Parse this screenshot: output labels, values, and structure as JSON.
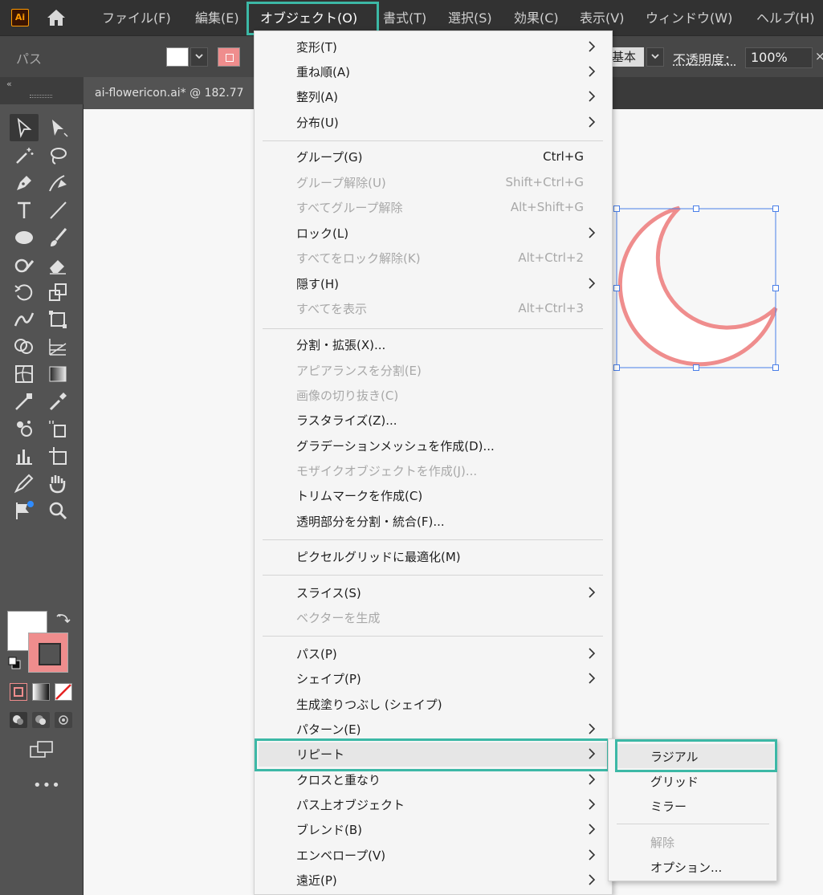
{
  "menubar": {
    "logo": "Ai",
    "items": [
      "ファイル(F)",
      "編集(E)",
      "オブジェクト(O)",
      "書式(T)",
      "選択(S)",
      "効果(C)",
      "表示(V)",
      "ウィンドウ(W)",
      "ヘルプ(H)"
    ]
  },
  "controlbar": {
    "label": "パス",
    "style_value": "基本",
    "opacity_label": "不透明度：",
    "opacity_value": "100%",
    "more": "×"
  },
  "document": {
    "tab_title": "ai-flowericon.ai* @ 182.77"
  },
  "object_menu": {
    "items": [
      {
        "label": "変形(T)",
        "shortcut": "",
        "submenu": true,
        "enabled": true
      },
      {
        "label": "重ね順(A)",
        "shortcut": "",
        "submenu": true,
        "enabled": true
      },
      {
        "label": "整列(A)",
        "shortcut": "",
        "submenu": true,
        "enabled": true
      },
      {
        "label": "分布(U)",
        "shortcut": "",
        "submenu": true,
        "enabled": true
      },
      {
        "label": "グループ(G)",
        "shortcut": "Ctrl+G",
        "submenu": false,
        "enabled": true
      },
      {
        "label": "グループ解除(U)",
        "shortcut": "Shift+Ctrl+G",
        "submenu": false,
        "enabled": false
      },
      {
        "label": "すべてグループ解除",
        "shortcut": "Alt+Shift+G",
        "submenu": false,
        "enabled": false
      },
      {
        "label": "ロック(L)",
        "shortcut": "",
        "submenu": true,
        "enabled": true
      },
      {
        "label": "すべてをロック解除(K)",
        "shortcut": "Alt+Ctrl+2",
        "submenu": false,
        "enabled": false
      },
      {
        "label": "隠す(H)",
        "shortcut": "",
        "submenu": true,
        "enabled": true
      },
      {
        "label": "すべてを表示",
        "shortcut": "Alt+Ctrl+3",
        "submenu": false,
        "enabled": false
      },
      {
        "label": "分割・拡張(X)...",
        "shortcut": "",
        "submenu": false,
        "enabled": true
      },
      {
        "label": "アピアランスを分割(E)",
        "shortcut": "",
        "submenu": false,
        "enabled": false
      },
      {
        "label": "画像の切り抜き(C)",
        "shortcut": "",
        "submenu": false,
        "enabled": false
      },
      {
        "label": "ラスタライズ(Z)...",
        "shortcut": "",
        "submenu": false,
        "enabled": true
      },
      {
        "label": "グラデーションメッシュを作成(D)...",
        "shortcut": "",
        "submenu": false,
        "enabled": true
      },
      {
        "label": "モザイクオブジェクトを作成(J)...",
        "shortcut": "",
        "submenu": false,
        "enabled": false
      },
      {
        "label": "トリムマークを作成(C)",
        "shortcut": "",
        "submenu": false,
        "enabled": true
      },
      {
        "label": "透明部分を分割・統合(F)...",
        "shortcut": "",
        "submenu": false,
        "enabled": true
      },
      {
        "label": "ピクセルグリッドに最適化(M)",
        "shortcut": "",
        "submenu": false,
        "enabled": true
      },
      {
        "label": "スライス(S)",
        "shortcut": "",
        "submenu": true,
        "enabled": true
      },
      {
        "label": "ベクターを生成",
        "shortcut": "",
        "submenu": false,
        "enabled": false
      },
      {
        "label": "パス(P)",
        "shortcut": "",
        "submenu": true,
        "enabled": true
      },
      {
        "label": "シェイプ(P)",
        "shortcut": "",
        "submenu": true,
        "enabled": true
      },
      {
        "label": "生成塗りつぶし (シェイプ)",
        "shortcut": "",
        "submenu": false,
        "enabled": true
      },
      {
        "label": "パターン(E)",
        "shortcut": "",
        "submenu": true,
        "enabled": true
      },
      {
        "label": "リピート",
        "shortcut": "",
        "submenu": true,
        "enabled": true
      },
      {
        "label": "クロスと重なり",
        "shortcut": "",
        "submenu": true,
        "enabled": true
      },
      {
        "label": "パス上オブジェクト",
        "shortcut": "",
        "submenu": true,
        "enabled": true
      },
      {
        "label": "ブレンド(B)",
        "shortcut": "",
        "submenu": true,
        "enabled": true
      },
      {
        "label": "エンベロープ(V)",
        "shortcut": "",
        "submenu": true,
        "enabled": true
      },
      {
        "label": "遠近(P)",
        "shortcut": "",
        "submenu": true,
        "enabled": true
      }
    ]
  },
  "repeat_submenu": {
    "items": [
      {
        "label": "ラジアル",
        "enabled": true
      },
      {
        "label": "グリッド",
        "enabled": true
      },
      {
        "label": "ミラー",
        "enabled": true
      },
      {
        "label": "解除",
        "enabled": false
      },
      {
        "label": "オプション...",
        "enabled": true
      }
    ]
  },
  "colors": {
    "highlight_outline": "#3cb8a6",
    "stroke_color": "#ef8d8d",
    "selection_color": "#4a7fe8"
  }
}
